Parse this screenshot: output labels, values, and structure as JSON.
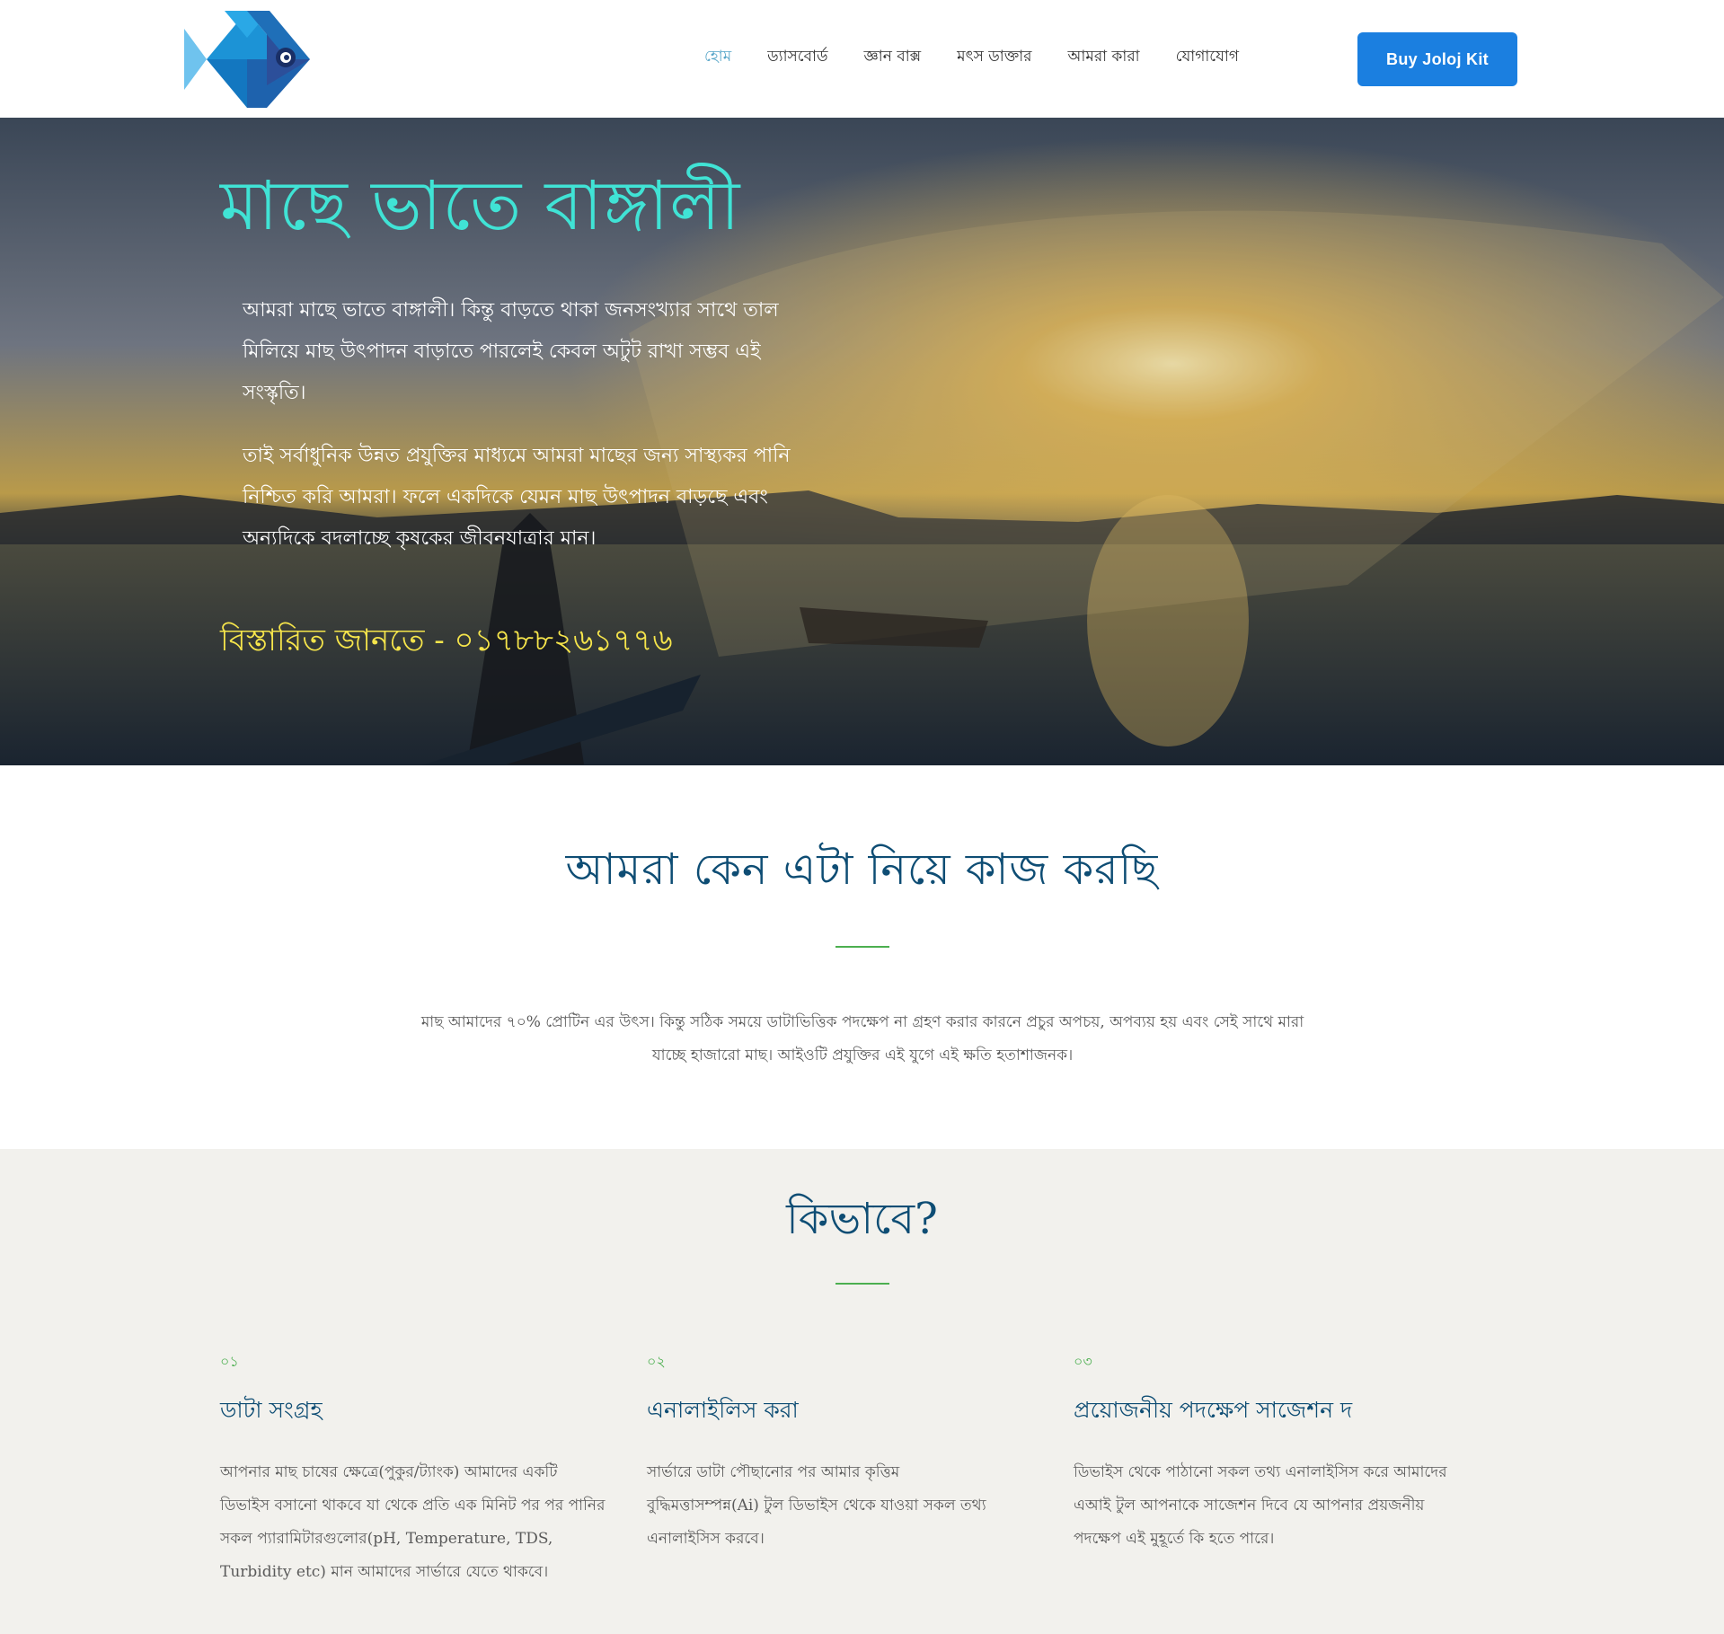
{
  "header": {
    "logo_name": "fish-logo",
    "nav": [
      {
        "label": "হোম",
        "active": true
      },
      {
        "label": "ড্যাসবোর্ড",
        "active": false
      },
      {
        "label": "জ্ঞান বাক্স",
        "active": false
      },
      {
        "label": "মৎস ডাক্তার",
        "active": false
      },
      {
        "label": "আমরা কারা",
        "active": false
      },
      {
        "label": "যোগাযোগ",
        "active": false
      }
    ],
    "buy_button": "Buy Joloj Kit"
  },
  "hero": {
    "title": "মাছে ভাতে বাঙ্গালী",
    "para1": "আমরা মাছে ভাতে বাঙ্গালী। কিন্তু বাড়তে থাকা জনসংখ্যার সাথে তাল মিলিয়ে মাছ উৎপাদন বাড়াতে পারলেই কেবল অটুট রাখা সম্ভব এই সংস্কৃতি।",
    "para2": "তাই সর্বাধুনিক উন্নত প্রযুক্তির মাধ্যমে আমরা মাছের জন্য সাস্থ্যকর পানি নিশ্চিত করি আমরা। ফলে একদিকে যেমন মাছ উৎপাদন বাড়ছে এবং অন্যদিকে বদলাচ্ছে কৃষকের জীবনযাত্রার মান।",
    "contact": "বিস্তারিত জানতে - ০১৭৮৮২৬১৭৭৬"
  },
  "why": {
    "title": "আমরা কেন এটা নিয়ে কাজ করছি",
    "text": "মাছ আমাদের ৭০% প্রোটিন এর উৎস। কিন্তু সঠিক সময়ে ডাটাভিত্তিক পদক্ষেপ না গ্রহণ করার কারনে প্রচুর অপচয়, অপব্যয় হয় এবং সেই সাথে মারা যাচ্ছে হাজারো মাছ। আইওটি প্রযুক্তির এই যুগে এই ক্ষতি হতাশাজনক।"
  },
  "how": {
    "title": "কিভাবে?",
    "steps": [
      {
        "num": "০১",
        "title": "ডাটা সংগ্রহ",
        "text": "আপনার মাছ চাষের ক্ষেত্রে(পুকুর/ট্যাংক) আমাদের একটি ডিভাইস বসানো থাকবে যা থেকে প্রতি এক মিনিট পর পর পানির সকল প্যারামিটারগুলোর(pH, Temperature, TDS, Turbidity etc) মান আমাদের সার্ভারে যেতে থাকবে।"
      },
      {
        "num": "০২",
        "title": "এনালাইলিস করা",
        "text": "সার্ভারে ডাটা পৌছানোর পর আমার কৃত্তিম বুদ্ধিমত্তাসম্পন্ন(Ai) টুল ডিভাইস থেকে যাওয়া সকল তথ্য এনালাইসিস করবে।"
      },
      {
        "num": "০৩",
        "title": "প্রয়োজনীয় পদক্ষেপ সাজেশন দ",
        "text": "ডিভাইস থেকে পাঠানো সকল তথ্য এনালাইসিস করে আমাদের এআই টুল আপনাকে সাজেশন দিবে যে আপনার প্রয়জনীয় পদক্ষেপ এই মুহূর্তে কি হতে পারে।"
      }
    ]
  },
  "colors": {
    "hero_title": "#40e3d5",
    "hero_contact": "#f6e54b",
    "heading": "#0e4d74",
    "accent_green": "#4caf50",
    "button": "#1b7fe0",
    "nav_active": "#57a5c8"
  }
}
